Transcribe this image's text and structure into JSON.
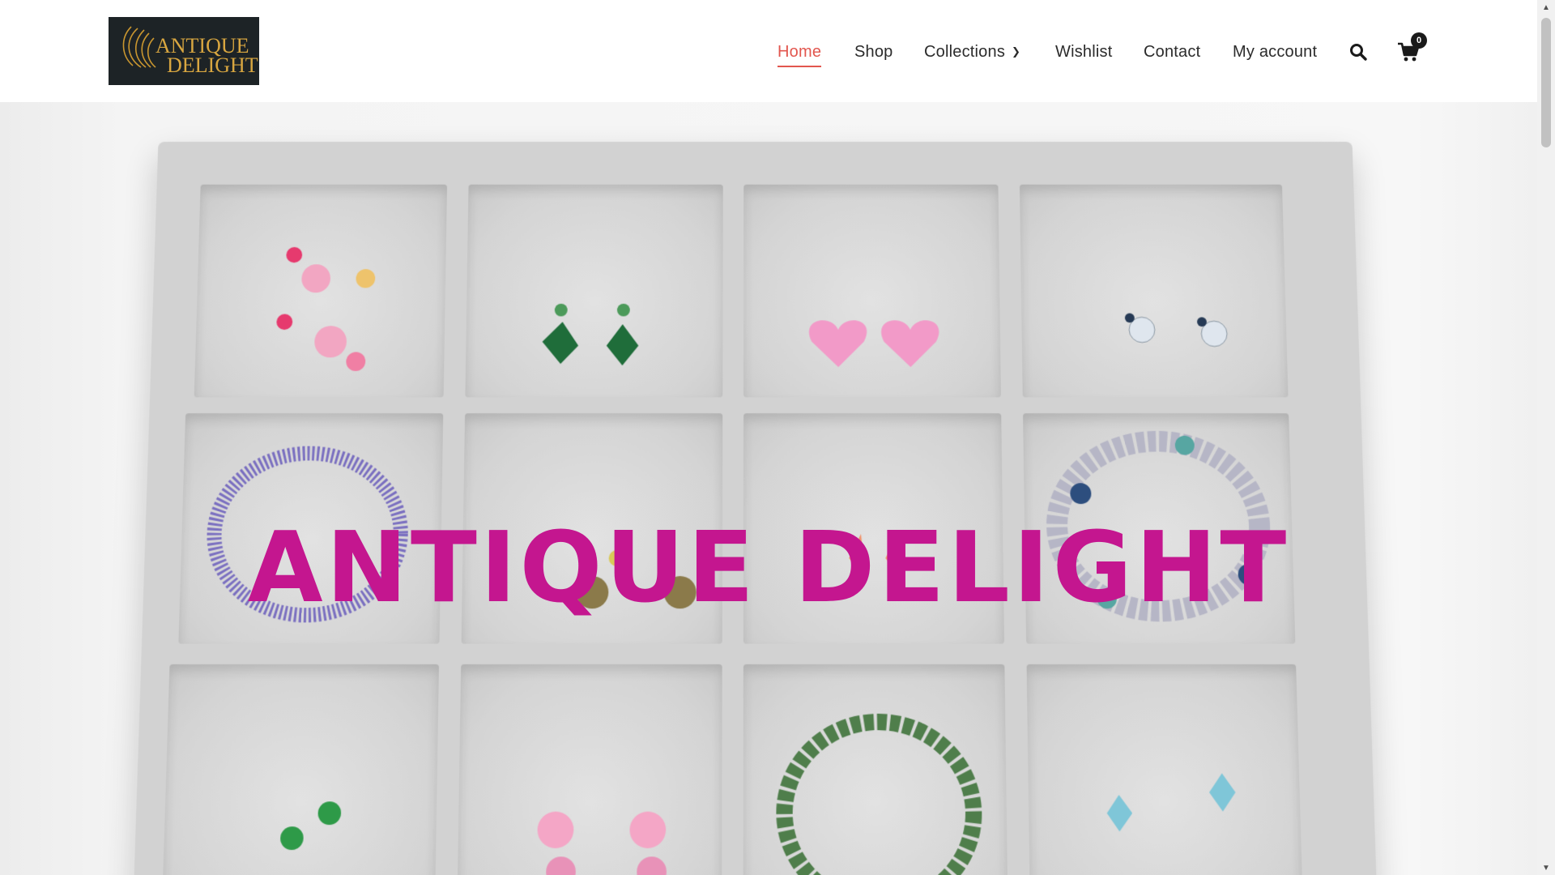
{
  "brand": {
    "logo_alt": "Antique Delight",
    "logo_text_line1": "ANTIQUE",
    "logo_text_line2": "DELIGHT",
    "logo_bg": "#1d2326",
    "logo_gold": "#c9962f"
  },
  "nav": {
    "items": [
      {
        "label": "Home",
        "active": true
      },
      {
        "label": "Shop",
        "active": false
      },
      {
        "label": "Collections",
        "active": false,
        "has_dropdown": true
      },
      {
        "label": "Wishlist",
        "active": false
      },
      {
        "label": "Contact",
        "active": false
      },
      {
        "label": "My account",
        "active": false
      }
    ],
    "search_icon": "search-icon",
    "cart_icon": "shopping-cart-icon",
    "cart_count": "0",
    "active_color": "#e2564e"
  },
  "hero": {
    "title": "ANTIQUE DELIGHT",
    "title_color": "#c4168f",
    "image_description_icon": "jewelry-tray-image"
  }
}
